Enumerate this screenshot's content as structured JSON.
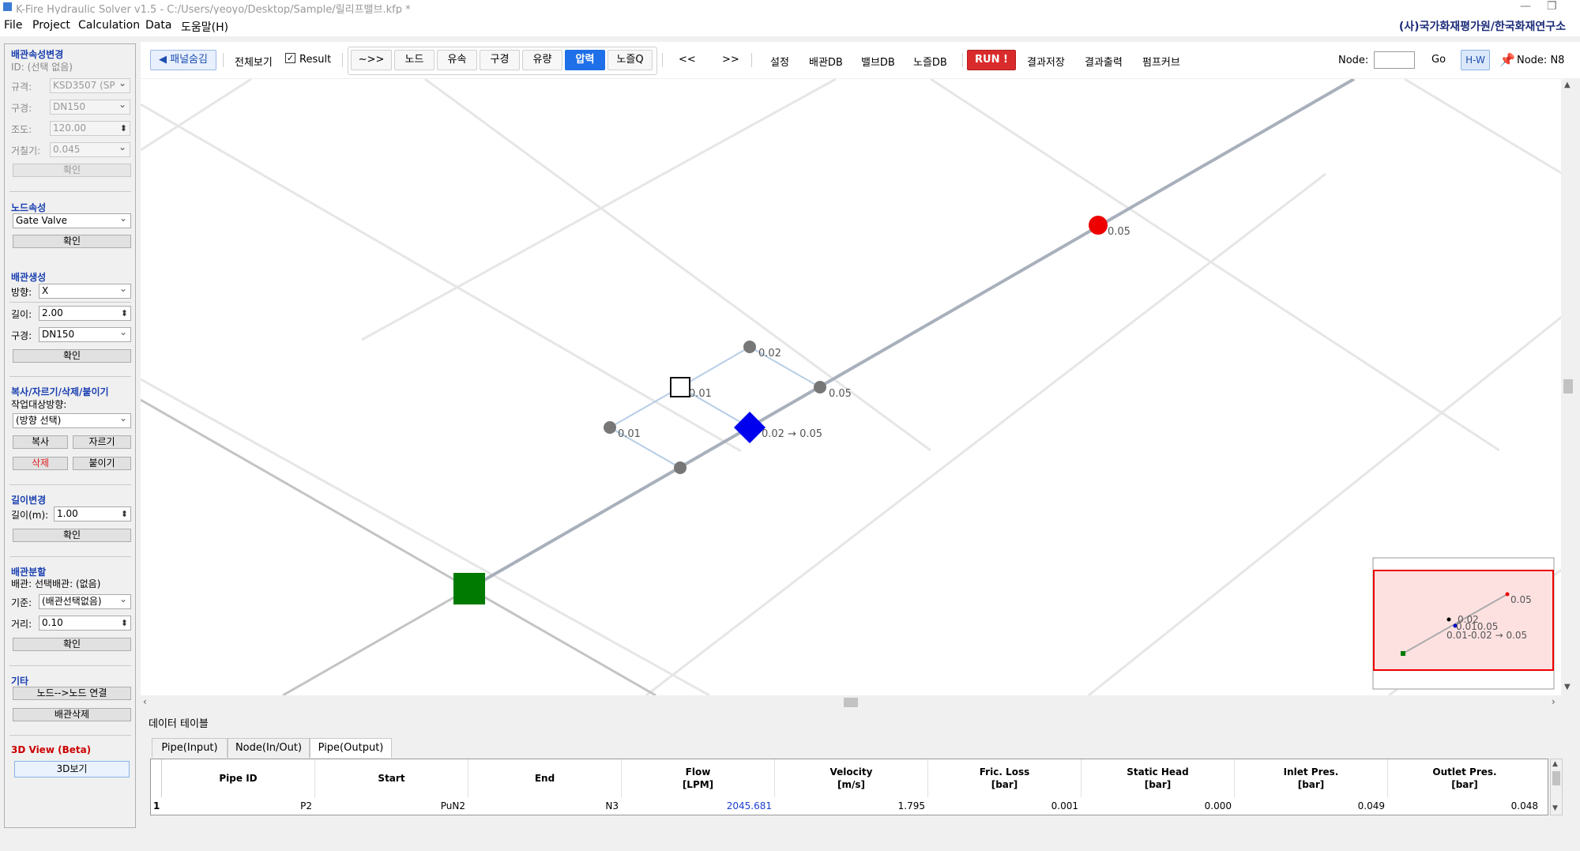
{
  "window": {
    "title": "K-Fire Hydraulic Solver v1.5 - C:/Users/yeoyo/Desktop/Sample/릴리프밸브.kfp *"
  },
  "menu": {
    "items": [
      "File",
      "Project",
      "Calculation",
      "Data",
      "도움말(H)"
    ],
    "org": "(사)국가화재평가원/한국화재연구소"
  },
  "left": {
    "pipe_attr": {
      "title": "배관속성변경",
      "id_text": "ID: (선택 없음)",
      "std_label": "규격:",
      "std_value": "KSD3507 (SP",
      "dia_label": "구경:",
      "dia_value": "DN150",
      "c_label": "조도:",
      "c_value": "120.00",
      "rough_label": "거칠기:",
      "rough_value": "0.045",
      "confirm": "확인"
    },
    "node_attr": {
      "title": "노드속성",
      "value": "Gate Valve",
      "confirm": "확인"
    },
    "pipe_create": {
      "title": "배관생성",
      "dir_label": "방향:",
      "dir_value": "X",
      "len_label": "길이:",
      "len_value": "2.00",
      "dia_label": "구경:",
      "dia_value": "DN150",
      "confirm": "확인"
    },
    "edit": {
      "title": "복사/자르기/삭제/붙이기",
      "target_label": "작업대상방향:",
      "target_value": "(방향 선택)",
      "copy": "복사",
      "cut": "자르기",
      "delete": "삭제",
      "paste": "붙이기"
    },
    "len_change": {
      "title": "길이변경",
      "label": "길이(m):",
      "value": "1.00",
      "confirm": "확인"
    },
    "split": {
      "title": "배관분할",
      "info": "배관: 선택배관: (없음)",
      "basis_label": "기준:",
      "basis_value": "(배관선택없음)",
      "dist_label": "거리:",
      "dist_value": "0.10",
      "confirm": "확인"
    },
    "etc": {
      "title": "기타",
      "connect": "노드-->노드 연결",
      "delete_pipe": "배관삭제"
    },
    "view3d": {
      "title": "3D View (Beta)",
      "button": "3D보기"
    }
  },
  "toolbar": {
    "hide_panel": "◀ 패널숨김",
    "full_view": "전체보기",
    "result_label": "Result",
    "result_checked": true,
    "modes": [
      "~>>",
      "노드",
      "유속",
      "구경",
      "유량",
      "압력",
      "노즐Q"
    ],
    "active_mode": "압력",
    "prev": "<<",
    "next": ">>",
    "menu_buttons": [
      "설정",
      "배관DB",
      "밸브DB",
      "노즐DB"
    ],
    "run": "RUN !",
    "after_run": [
      "결과저장",
      "결과출력",
      "펌프커브"
    ],
    "node_label": "Node:",
    "node_value": "",
    "go": "Go",
    "hw": "H-W",
    "node_status": "Node: N8"
  },
  "canvas_labels": {
    "red": "0.05",
    "n_top": "0.02",
    "n_right": "0.05",
    "square": "0.01",
    "n_left": "0.01",
    "diamond": "0.02 → 0.05"
  },
  "minimap": {
    "labels": [
      "0.05",
      "0.02",
      "0.010.05",
      "0.01-0.02 → 0.05"
    ]
  },
  "datapanel": {
    "title": "데이터 테이블",
    "tabs": [
      "Pipe(Input)",
      "Node(In/Out)",
      "Pipe(Output)"
    ],
    "active_tab": "Pipe(Output)",
    "columns": [
      {
        "key": "id",
        "label": "Pipe ID"
      },
      {
        "key": "start",
        "label": "Start"
      },
      {
        "key": "end",
        "label": "End"
      },
      {
        "key": "flow",
        "label": "Flow\n[LPM]"
      },
      {
        "key": "velocity",
        "label": "Velocity\n[m/s]"
      },
      {
        "key": "fric",
        "label": "Fric. Loss\n[bar]"
      },
      {
        "key": "static",
        "label": "Static Head\n[bar]"
      },
      {
        "key": "inlet",
        "label": "Inlet Pres.\n[bar]"
      },
      {
        "key": "outlet",
        "label": "Outlet Pres.\n[bar]"
      }
    ],
    "rows": [
      {
        "num": "1",
        "id": "P2",
        "start": "PuN2",
        "end": "N3",
        "flow": "2045.681",
        "velocity": "1.795",
        "fric": "0.001",
        "static": "0.000",
        "inlet": "0.049",
        "outlet": "0.048"
      }
    ]
  },
  "colors": {
    "accent": "#1e6fe8",
    "run": "#d92b2b",
    "red_node": "#ee0000",
    "blue_node": "#0000ee",
    "green_node": "#007a00"
  }
}
